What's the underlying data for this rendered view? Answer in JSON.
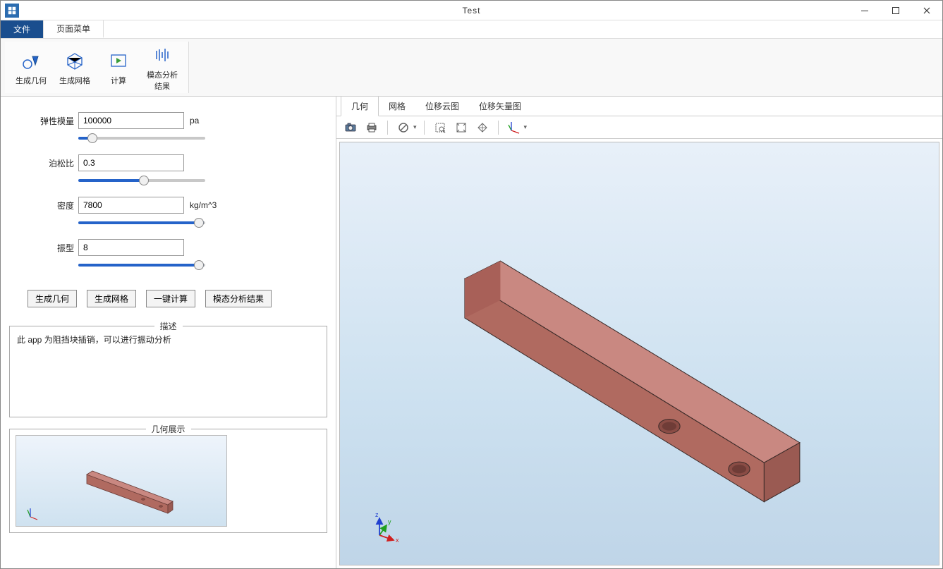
{
  "window": {
    "title": "Test"
  },
  "menu": {
    "file": "文件",
    "page": "页面菜单"
  },
  "ribbon": {
    "genGeom": "生成几何",
    "genMesh": "生成网格",
    "compute": "计算",
    "modalResult": "模态分析结果"
  },
  "params": {
    "elasticLabel": "弹性模量",
    "elasticValue": "100000",
    "elasticUnit": "pa",
    "poissonLabel": "泊松比",
    "poissonValue": "0.3",
    "densityLabel": "密度",
    "densityValue": "7800",
    "densityUnit": "kg/m^3",
    "modeLabel": "振型",
    "modeValue": "8"
  },
  "buttons": {
    "genGeom": "生成几何",
    "genMesh": "生成网格",
    "oneClick": "一键计算",
    "modalResult": "模态分析结果"
  },
  "sections": {
    "descTitle": "描述",
    "descText": "此 app 为阻挡块插销，可以进行振动分析",
    "geoTitle": "几何展示"
  },
  "viewTabs": {
    "geom": "几何",
    "mesh": "网格",
    "dispCloud": "位移云图",
    "dispVector": "位移矢量图"
  },
  "axis": {
    "x": "x",
    "y": "y",
    "z": "z"
  }
}
